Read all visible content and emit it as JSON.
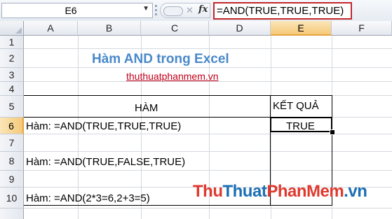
{
  "formula_bar": {
    "name_box": "E6",
    "fx_label": "fx",
    "formula": "=AND(TRUE,TRUE,TRUE)"
  },
  "columns": [
    "A",
    "B",
    "C",
    "D",
    "E",
    "F"
  ],
  "selected_column": "E",
  "rows": [
    "1",
    "2",
    "3",
    "4",
    "5",
    "6",
    "7",
    "8",
    "9",
    "10"
  ],
  "selected_row": "6",
  "cells": {
    "title": "Hàm AND trong Excel",
    "link": "thuthuatphanmem.vn",
    "header_ham": "HÀM",
    "header_ket_qua": "KẾT QUẢ",
    "a6": "Hàm: =AND(TRUE,TRUE,TRUE)",
    "e6": "TRUE",
    "a8": "Hàm: =AND(TRUE,FALSE,TRUE)",
    "a10": "Hàm: =AND(2*3=6,2+3=5)"
  },
  "watermark": {
    "part1": "Thu",
    "part2": "Thuat",
    "part3": "PhanMem",
    "part4": ".vn"
  }
}
